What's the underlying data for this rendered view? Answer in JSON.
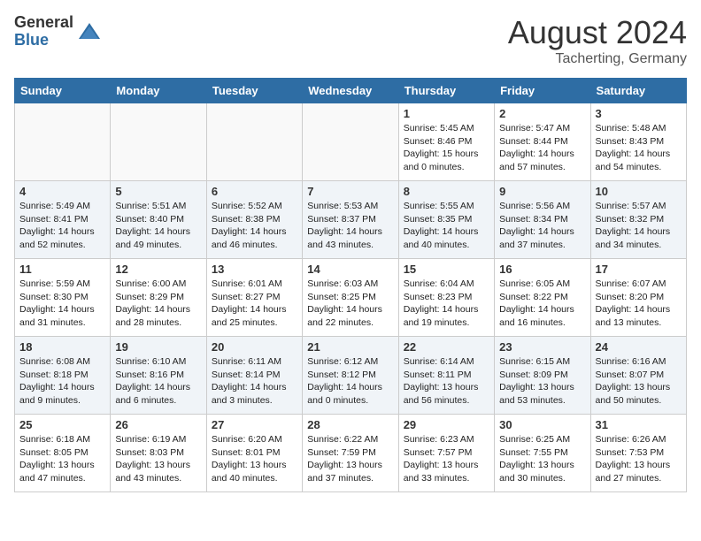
{
  "header": {
    "logo_general": "General",
    "logo_blue": "Blue",
    "month_year": "August 2024",
    "location": "Tacherting, Germany"
  },
  "weekdays": [
    "Sunday",
    "Monday",
    "Tuesday",
    "Wednesday",
    "Thursday",
    "Friday",
    "Saturday"
  ],
  "weeks": [
    [
      {
        "day": "",
        "info": ""
      },
      {
        "day": "",
        "info": ""
      },
      {
        "day": "",
        "info": ""
      },
      {
        "day": "",
        "info": ""
      },
      {
        "day": "1",
        "info": "Sunrise: 5:45 AM\nSunset: 8:46 PM\nDaylight: 15 hours\nand 0 minutes."
      },
      {
        "day": "2",
        "info": "Sunrise: 5:47 AM\nSunset: 8:44 PM\nDaylight: 14 hours\nand 57 minutes."
      },
      {
        "day": "3",
        "info": "Sunrise: 5:48 AM\nSunset: 8:43 PM\nDaylight: 14 hours\nand 54 minutes."
      }
    ],
    [
      {
        "day": "4",
        "info": "Sunrise: 5:49 AM\nSunset: 8:41 PM\nDaylight: 14 hours\nand 52 minutes."
      },
      {
        "day": "5",
        "info": "Sunrise: 5:51 AM\nSunset: 8:40 PM\nDaylight: 14 hours\nand 49 minutes."
      },
      {
        "day": "6",
        "info": "Sunrise: 5:52 AM\nSunset: 8:38 PM\nDaylight: 14 hours\nand 46 minutes."
      },
      {
        "day": "7",
        "info": "Sunrise: 5:53 AM\nSunset: 8:37 PM\nDaylight: 14 hours\nand 43 minutes."
      },
      {
        "day": "8",
        "info": "Sunrise: 5:55 AM\nSunset: 8:35 PM\nDaylight: 14 hours\nand 40 minutes."
      },
      {
        "day": "9",
        "info": "Sunrise: 5:56 AM\nSunset: 8:34 PM\nDaylight: 14 hours\nand 37 minutes."
      },
      {
        "day": "10",
        "info": "Sunrise: 5:57 AM\nSunset: 8:32 PM\nDaylight: 14 hours\nand 34 minutes."
      }
    ],
    [
      {
        "day": "11",
        "info": "Sunrise: 5:59 AM\nSunset: 8:30 PM\nDaylight: 14 hours\nand 31 minutes."
      },
      {
        "day": "12",
        "info": "Sunrise: 6:00 AM\nSunset: 8:29 PM\nDaylight: 14 hours\nand 28 minutes."
      },
      {
        "day": "13",
        "info": "Sunrise: 6:01 AM\nSunset: 8:27 PM\nDaylight: 14 hours\nand 25 minutes."
      },
      {
        "day": "14",
        "info": "Sunrise: 6:03 AM\nSunset: 8:25 PM\nDaylight: 14 hours\nand 22 minutes."
      },
      {
        "day": "15",
        "info": "Sunrise: 6:04 AM\nSunset: 8:23 PM\nDaylight: 14 hours\nand 19 minutes."
      },
      {
        "day": "16",
        "info": "Sunrise: 6:05 AM\nSunset: 8:22 PM\nDaylight: 14 hours\nand 16 minutes."
      },
      {
        "day": "17",
        "info": "Sunrise: 6:07 AM\nSunset: 8:20 PM\nDaylight: 14 hours\nand 13 minutes."
      }
    ],
    [
      {
        "day": "18",
        "info": "Sunrise: 6:08 AM\nSunset: 8:18 PM\nDaylight: 14 hours\nand 9 minutes."
      },
      {
        "day": "19",
        "info": "Sunrise: 6:10 AM\nSunset: 8:16 PM\nDaylight: 14 hours\nand 6 minutes."
      },
      {
        "day": "20",
        "info": "Sunrise: 6:11 AM\nSunset: 8:14 PM\nDaylight: 14 hours\nand 3 minutes."
      },
      {
        "day": "21",
        "info": "Sunrise: 6:12 AM\nSunset: 8:12 PM\nDaylight: 14 hours\nand 0 minutes."
      },
      {
        "day": "22",
        "info": "Sunrise: 6:14 AM\nSunset: 8:11 PM\nDaylight: 13 hours\nand 56 minutes."
      },
      {
        "day": "23",
        "info": "Sunrise: 6:15 AM\nSunset: 8:09 PM\nDaylight: 13 hours\nand 53 minutes."
      },
      {
        "day": "24",
        "info": "Sunrise: 6:16 AM\nSunset: 8:07 PM\nDaylight: 13 hours\nand 50 minutes."
      }
    ],
    [
      {
        "day": "25",
        "info": "Sunrise: 6:18 AM\nSunset: 8:05 PM\nDaylight: 13 hours\nand 47 minutes."
      },
      {
        "day": "26",
        "info": "Sunrise: 6:19 AM\nSunset: 8:03 PM\nDaylight: 13 hours\nand 43 minutes."
      },
      {
        "day": "27",
        "info": "Sunrise: 6:20 AM\nSunset: 8:01 PM\nDaylight: 13 hours\nand 40 minutes."
      },
      {
        "day": "28",
        "info": "Sunrise: 6:22 AM\nSunset: 7:59 PM\nDaylight: 13 hours\nand 37 minutes."
      },
      {
        "day": "29",
        "info": "Sunrise: 6:23 AM\nSunset: 7:57 PM\nDaylight: 13 hours\nand 33 minutes."
      },
      {
        "day": "30",
        "info": "Sunrise: 6:25 AM\nSunset: 7:55 PM\nDaylight: 13 hours\nand 30 minutes."
      },
      {
        "day": "31",
        "info": "Sunrise: 6:26 AM\nSunset: 7:53 PM\nDaylight: 13 hours\nand 27 minutes."
      }
    ]
  ]
}
